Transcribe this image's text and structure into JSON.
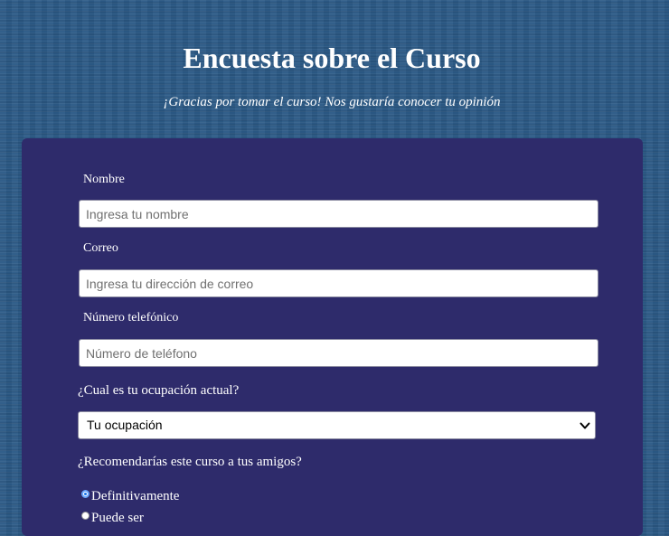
{
  "header": {
    "title": "Encuesta sobre el Curso",
    "subtitle": "¡Gracias por tomar el curso! Nos gustaría conocer tu opinión"
  },
  "form": {
    "name_label": "Nombre",
    "name_placeholder": "Ingresa tu nombre",
    "email_label": "Correo",
    "email_placeholder": "Ingresa tu dirección de correo",
    "phone_label": "Número telefónico",
    "phone_placeholder": "Número de teléfono",
    "occupation_question": "¿Cual es tu ocupación actual?",
    "occupation_selected": "Tu ocupación",
    "recommend_question": "¿Recomendarías este curso a tus amigos?",
    "recommend_options": [
      {
        "label": "Definitivamente",
        "checked": true
      },
      {
        "label": "Puede ser",
        "checked": false
      }
    ]
  },
  "colors": {
    "page_background": "#2b5a86",
    "form_background": "#2e2b6b",
    "text": "#ffffff"
  },
  "icons": {
    "select_arrow": "chevron-down-icon"
  }
}
